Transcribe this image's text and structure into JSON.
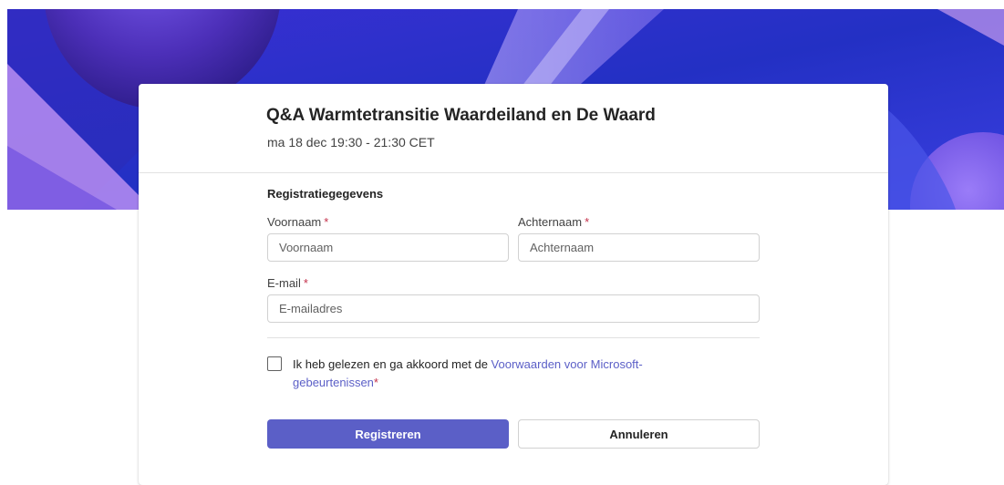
{
  "event": {
    "title": "Q&A Warmtetransitie Waardeiland en De Waard",
    "time": "ma 18 dec 19:30 - 21:30 CET"
  },
  "form": {
    "section_title": "Registratiegegevens",
    "required_marker": "*",
    "first_name": {
      "label": "Voornaam",
      "placeholder": "Voornaam",
      "value": ""
    },
    "last_name": {
      "label": "Achternaam",
      "placeholder": "Achternaam",
      "value": ""
    },
    "email": {
      "label": "E-mail",
      "placeholder": "E-mailadres",
      "value": ""
    },
    "terms": {
      "checked": false,
      "text": "Ik heb gelezen en ga akkoord met de ",
      "link": "Voorwaarden voor Microsoft-gebeurtenissen",
      "required_marker": "*"
    }
  },
  "buttons": {
    "register_label": "Registreren",
    "cancel_label": "Annuleren"
  },
  "colors": {
    "accent": "#5b5fc7",
    "required": "#c4314b",
    "banner_base": "#2a2ec8",
    "banner_highlight": "#b08cf5"
  }
}
